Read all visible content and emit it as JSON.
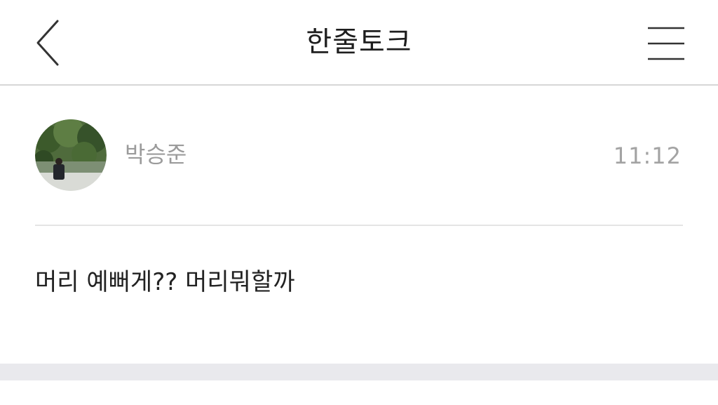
{
  "header": {
    "title": "한줄토크",
    "back_icon": "chevron-left-icon",
    "menu_icon": "hamburger-menu-icon"
  },
  "post": {
    "author": "박승준",
    "time": "11:12",
    "message": "머리 예뻐게?? 머리뭐할까",
    "avatar_icon": "profile-photo"
  },
  "colors": {
    "background": "#ffffff",
    "divider": "#e4e4e4",
    "muted_text": "#9b9b9b",
    "footer_band": "#e9e9ed"
  }
}
